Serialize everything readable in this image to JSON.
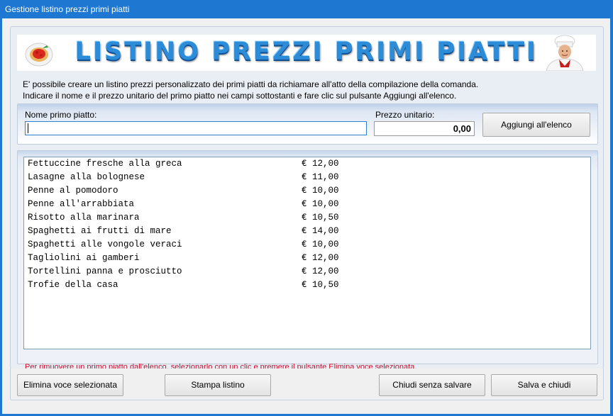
{
  "window": {
    "title": "Gestione listino prezzi primi piatti"
  },
  "banner": {
    "title": "LISTINO PREZZI PRIMI PIATTI"
  },
  "instructions": {
    "line1": "E' possibile creare un listino prezzi personalizzato dei primi piatti da richiamare all'atto della compilazione della comanda.",
    "line2": "Indicare il nome e il prezzo unitario del primo piatto nei campi sottostanti e fare clic sul pulsante Aggiungi all'elenco."
  },
  "form": {
    "name_label": "Nome primo piatto:",
    "name_value": "",
    "price_label": "Prezzo unitario:",
    "price_value": "0,00",
    "add_button": "Aggiungi all'elenco"
  },
  "list": {
    "items": [
      {
        "name": "Fettuccine fresche alla greca",
        "price": "€ 12,00"
      },
      {
        "name": "Lasagne alla bolognese",
        "price": "€ 11,00"
      },
      {
        "name": "Penne al pomodoro",
        "price": "€ 10,00"
      },
      {
        "name": "Penne all'arrabbiata",
        "price": "€ 10,00"
      },
      {
        "name": "Risotto alla marinara",
        "price": "€ 10,50"
      },
      {
        "name": "Spaghetti ai frutti di mare",
        "price": "€ 14,00"
      },
      {
        "name": "Spaghetti alle vongole veraci",
        "price": "€ 10,00"
      },
      {
        "name": "Tagliolini ai gamberi",
        "price": "€ 12,00"
      },
      {
        "name": "Tortellini panna e prosciutto",
        "price": "€ 12,00"
      },
      {
        "name": "Trofie della casa",
        "price": "€ 10,50"
      }
    ],
    "hint": "Per rimuovere un primo piatto dall'elenco, selezionarlo con un clic e premere il pulsante Elimina voce selezionata."
  },
  "buttons": {
    "delete": "Elimina voce selezionata",
    "print": "Stampa listino",
    "close_no_save": "Chiudi senza salvare",
    "save_close": "Salva e chiudi"
  },
  "colors": {
    "titlebar": "#1e78d2",
    "hint": "#c8102e",
    "banner_text": "#2d8cd8"
  },
  "icons": {
    "banner_left": "pasta-plate-icon",
    "banner_right": "chef-icon"
  }
}
